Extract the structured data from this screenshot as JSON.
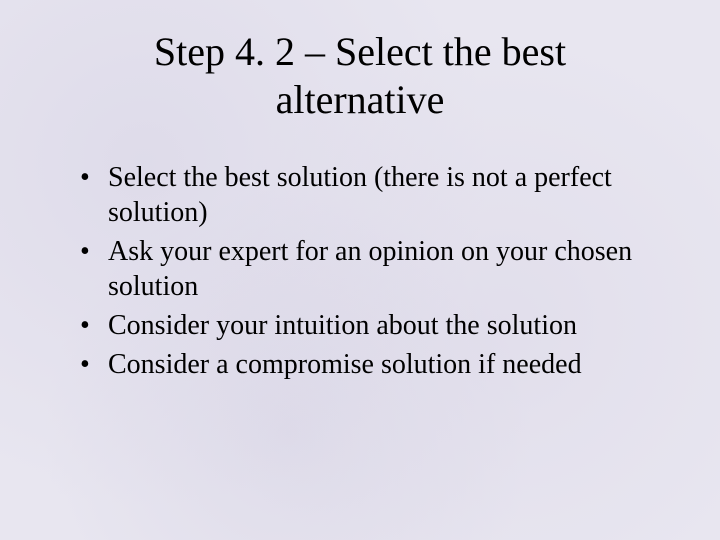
{
  "slide": {
    "title": "Step 4. 2 – Select the best alternative",
    "bullets": [
      "Select the best solution  (there is not a perfect solution)",
      "Ask your expert for an opinion on your chosen solution",
      "Consider your intuition about the solution",
      "Consider a compromise solution if needed"
    ]
  }
}
